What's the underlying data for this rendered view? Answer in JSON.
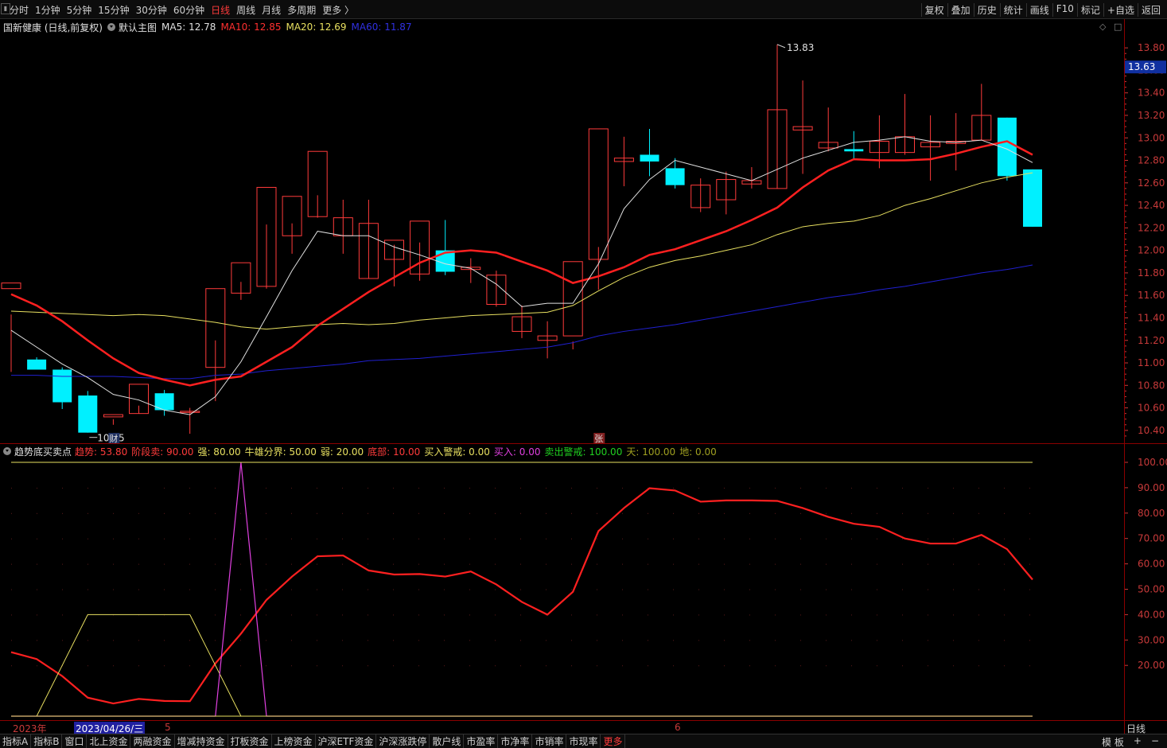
{
  "toolbar": {
    "left": [
      "分时",
      "1分钟",
      "5分钟",
      "15分钟",
      "30分钟",
      "60分钟",
      "日线",
      "周线",
      "月线",
      "多周期",
      "更多 〉"
    ],
    "active": "日线",
    "right": [
      "复权",
      "叠加",
      "历史",
      "统计",
      "画线",
      "F10",
      "标记",
      "+自选",
      "返回"
    ]
  },
  "main_info": {
    "stock": "国新健康 (日线,前复权)",
    "template": "默认主图",
    "ma5": "MA5: 12.78",
    "ma10": "MA10: 12.85",
    "ma20": "MA20: 12.69",
    "ma60": "MA60: 11.87"
  },
  "colors": {
    "up": "#ff3b3b",
    "down": "#00f0ff",
    "ma5": "#e0e0e0",
    "ma10": "#ff2020",
    "ma20": "#e8e060",
    "ma60": "#2020d0",
    "trend": "#ff2020",
    "yellow": "#e8e060",
    "magenta": "#e040e0",
    "axis": "#c83a3a"
  },
  "sub_info": {
    "name": "趋势底买卖点",
    "items": [
      {
        "label": "趋势:",
        "value": "53.80",
        "color": "#ff3b3b"
      },
      {
        "label": "阶段卖:",
        "value": "90.00",
        "color": "#ff3b3b"
      },
      {
        "label": "强:",
        "value": "80.00",
        "color": "#e8e060"
      },
      {
        "label": "牛雄分界:",
        "value": "50.00",
        "color": "#e8e060"
      },
      {
        "label": "弱:",
        "value": "20.00",
        "color": "#e8e060"
      },
      {
        "label": "底部:",
        "value": "10.00",
        "color": "#ff3b3b"
      },
      {
        "label": "买入警戒:",
        "value": "0.00",
        "color": "#e8e060"
      },
      {
        "label": "买入:",
        "value": "0.00",
        "color": "#e040e0"
      },
      {
        "label": "卖出警戒:",
        "value": "100.00",
        "color": "#20d020"
      },
      {
        "label": "天:",
        "value": "100.00",
        "color": "#a0a020"
      },
      {
        "label": "地:",
        "value": "0.00",
        "color": "#a0a020"
      }
    ]
  },
  "chart_data": [
    {
      "type": "candlestick",
      "price_axis": {
        "min": 10.3,
        "max": 13.9,
        "ticks": [
          "13.80",
          "13.60",
          "13.40",
          "13.20",
          "13.00",
          "12.80",
          "12.60",
          "12.40",
          "12.20",
          "12.00",
          "11.80",
          "11.60",
          "11.40",
          "11.20",
          "11.00",
          "10.80",
          "10.60",
          "10.40"
        ]
      },
      "current_price": "13.63",
      "annotations": {
        "high": "13.83",
        "low": "10.35",
        "marker_cai": "财",
        "marker_zhang": "张"
      },
      "candles": [
        [
          11.66,
          11.43,
          11.71,
          10.92
        ],
        [
          11.03,
          11.05,
          10.94,
          10.94
        ],
        [
          10.94,
          10.96,
          10.65,
          10.59
        ],
        [
          10.71,
          10.75,
          10.38,
          10.38
        ],
        [
          10.52,
          10.5,
          10.54,
          10.45
        ],
        [
          10.55,
          10.62,
          10.81,
          10.55
        ],
        [
          10.73,
          10.76,
          10.58,
          10.53
        ],
        [
          10.56,
          10.6,
          10.57,
          10.37
        ],
        [
          10.96,
          11.2,
          11.66,
          10.66
        ],
        [
          11.62,
          11.72,
          11.89,
          11.56
        ],
        [
          11.68,
          12.23,
          12.56,
          11.66
        ],
        [
          12.13,
          12.24,
          12.48,
          11.97
        ],
        [
          12.3,
          12.49,
          12.88,
          12.29
        ],
        [
          12.13,
          12.45,
          12.29,
          11.97
        ],
        [
          11.75,
          12.45,
          12.24,
          11.75
        ],
        [
          11.92,
          12.05,
          12.09,
          11.68
        ],
        [
          11.79,
          12.07,
          12.26,
          11.73
        ],
        [
          12.0,
          12.27,
          11.81,
          11.78
        ],
        [
          11.83,
          11.93,
          11.85,
          11.71
        ],
        [
          11.52,
          11.82,
          11.78,
          11.5
        ],
        [
          11.28,
          11.51,
          11.41,
          11.22
        ],
        [
          11.2,
          11.37,
          11.24,
          11.04
        ],
        [
          11.24,
          11.19,
          11.9,
          11.12
        ],
        [
          11.92,
          11.65,
          13.08,
          12.03
        ],
        [
          12.79,
          13.01,
          12.82,
          12.57
        ],
        [
          12.85,
          13.08,
          12.79,
          12.66
        ],
        [
          12.73,
          12.82,
          12.58,
          12.55
        ],
        [
          12.38,
          12.64,
          12.58,
          12.34
        ],
        [
          12.45,
          12.7,
          12.63,
          12.32
        ],
        [
          12.59,
          12.74,
          12.62,
          12.55
        ],
        [
          12.55,
          13.83,
          13.25,
          12.55
        ],
        [
          13.07,
          13.51,
          13.1,
          12.68
        ],
        [
          12.91,
          13.27,
          12.96,
          12.88
        ],
        [
          12.9,
          13.06,
          12.88,
          12.81
        ],
        [
          12.87,
          13.2,
          12.97,
          12.73
        ],
        [
          12.87,
          13.39,
          13.01,
          12.85
        ],
        [
          12.92,
          13.2,
          12.96,
          12.62
        ],
        [
          12.95,
          13.22,
          12.97,
          12.71
        ],
        [
          12.98,
          13.48,
          13.2,
          12.98
        ],
        [
          13.18,
          13.18,
          12.66,
          12.62
        ],
        [
          12.72,
          12.72,
          12.21,
          12.21
        ]
      ],
      "ma5": [
        11.29,
        11.14,
        10.99,
        10.87,
        10.72,
        10.67,
        10.58,
        10.54,
        10.7,
        11.01,
        11.41,
        11.82,
        12.17,
        12.13,
        12.13,
        12.03,
        11.96,
        11.88,
        11.84,
        11.7,
        11.5,
        11.53,
        11.53,
        11.88,
        12.37,
        12.63,
        12.8,
        12.74,
        12.68,
        12.62,
        12.72,
        12.82,
        12.89,
        12.96,
        12.98,
        13.01,
        12.97,
        12.96,
        12.98,
        12.9,
        12.78
      ],
      "ma10": [
        11.61,
        11.51,
        11.37,
        11.2,
        11.04,
        10.91,
        10.85,
        10.8,
        10.85,
        10.88,
        11.01,
        11.14,
        11.33,
        11.48,
        11.63,
        11.76,
        11.89,
        11.98,
        12.0,
        11.98,
        11.9,
        11.82,
        11.71,
        11.77,
        11.85,
        11.96,
        12.01,
        12.09,
        12.17,
        12.27,
        12.38,
        12.56,
        12.71,
        12.81,
        12.8,
        12.8,
        12.81,
        12.86,
        12.92,
        12.97,
        12.85
      ],
      "ma20": [
        11.46,
        11.45,
        11.44,
        11.43,
        11.42,
        11.43,
        11.42,
        11.39,
        11.36,
        11.32,
        11.3,
        11.32,
        11.34,
        11.35,
        11.34,
        11.35,
        11.38,
        11.4,
        11.42,
        11.43,
        11.44,
        11.45,
        11.51,
        11.64,
        11.76,
        11.85,
        11.91,
        11.95,
        12.0,
        12.05,
        12.14,
        12.21,
        12.24,
        12.26,
        12.31,
        12.4,
        12.46,
        12.53,
        12.6,
        12.65,
        12.69
      ],
      "ma60": [
        10.89,
        10.89,
        10.88,
        10.88,
        10.88,
        10.87,
        10.86,
        10.86,
        10.89,
        10.9,
        10.93,
        10.95,
        10.97,
        10.99,
        11.02,
        11.03,
        11.04,
        11.06,
        11.08,
        11.1,
        11.12,
        11.14,
        11.18,
        11.24,
        11.28,
        11.31,
        11.34,
        11.38,
        11.42,
        11.46,
        11.5,
        11.54,
        11.58,
        11.61,
        11.65,
        11.68,
        11.72,
        11.76,
        11.8,
        11.83,
        11.87
      ]
    },
    {
      "type": "line",
      "y_axis": {
        "min": 0,
        "max": 104,
        "ticks": [
          "100.00",
          "90.00",
          "80.00",
          "70.00",
          "60.00",
          "50.00",
          "40.00",
          "30.00",
          "20.00"
        ]
      },
      "series": [
        {
          "name": "趋势",
          "values": [
            25.2,
            22.5,
            15.8,
            7.3,
            5.0,
            6.8,
            6.0,
            5.9,
            20.8,
            32.5,
            45.8,
            55.0,
            63.0,
            63.3,
            57.4,
            55.8,
            56.0,
            55.0,
            57.0,
            51.9,
            45.0,
            40.0,
            49.0,
            72.9,
            82.0,
            89.8,
            88.9,
            84.5,
            85.0,
            85.0,
            84.8,
            82.0,
            78.5,
            75.8,
            74.6,
            70.0,
            68.0,
            68.0,
            71.4,
            65.8,
            53.8
          ]
        },
        {
          "name": "强",
          "values": [
            0,
            0,
            20,
            40,
            40,
            40,
            40,
            40,
            20,
            0,
            0,
            0,
            0,
            0,
            0,
            0,
            0,
            0,
            0,
            0,
            0,
            0,
            0,
            0,
            0,
            0,
            0,
            0,
            0,
            0,
            0,
            0,
            0,
            0,
            0,
            0,
            0,
            0,
            0,
            0,
            0
          ]
        },
        {
          "name": "买入",
          "values": [
            0,
            0,
            0,
            0,
            0,
            0,
            0,
            0,
            0,
            100,
            0,
            0,
            0,
            0,
            0,
            0,
            0,
            0,
            0,
            0,
            0,
            0,
            0,
            0,
            0,
            0,
            0,
            0,
            0,
            0,
            0,
            0,
            0,
            0,
            0,
            0,
            0,
            0,
            0,
            0,
            0
          ]
        },
        {
          "name": "卖出警戒",
          "values": [
            100,
            100,
            100,
            100,
            100,
            100,
            100,
            100,
            100,
            100,
            100,
            100,
            100,
            100,
            100,
            100,
            100,
            100,
            100,
            100,
            100,
            100,
            100,
            100,
            100,
            100,
            100,
            100,
            100,
            100,
            100,
            100,
            100,
            100,
            100,
            100,
            100,
            100,
            100,
            100,
            100
          ]
        }
      ]
    }
  ],
  "dates": {
    "year": "2023年",
    "cursor": "2023/04/26/三",
    "m5": "5",
    "m6": "6"
  },
  "period": "日线",
  "bottom_tabs": [
    "指标A",
    "指标B",
    "窗口",
    "北上资金",
    "两融资金",
    "增减持资金",
    "打板资金",
    "上榜资金",
    "沪深ETF资金",
    "沪深涨跌停",
    "散户线",
    "市盈率",
    "市净率",
    "市销率",
    "市现率",
    "更多"
  ],
  "bottom_active": "更多",
  "bottom_right": [
    "模 板",
    "+",
    "−"
  ]
}
